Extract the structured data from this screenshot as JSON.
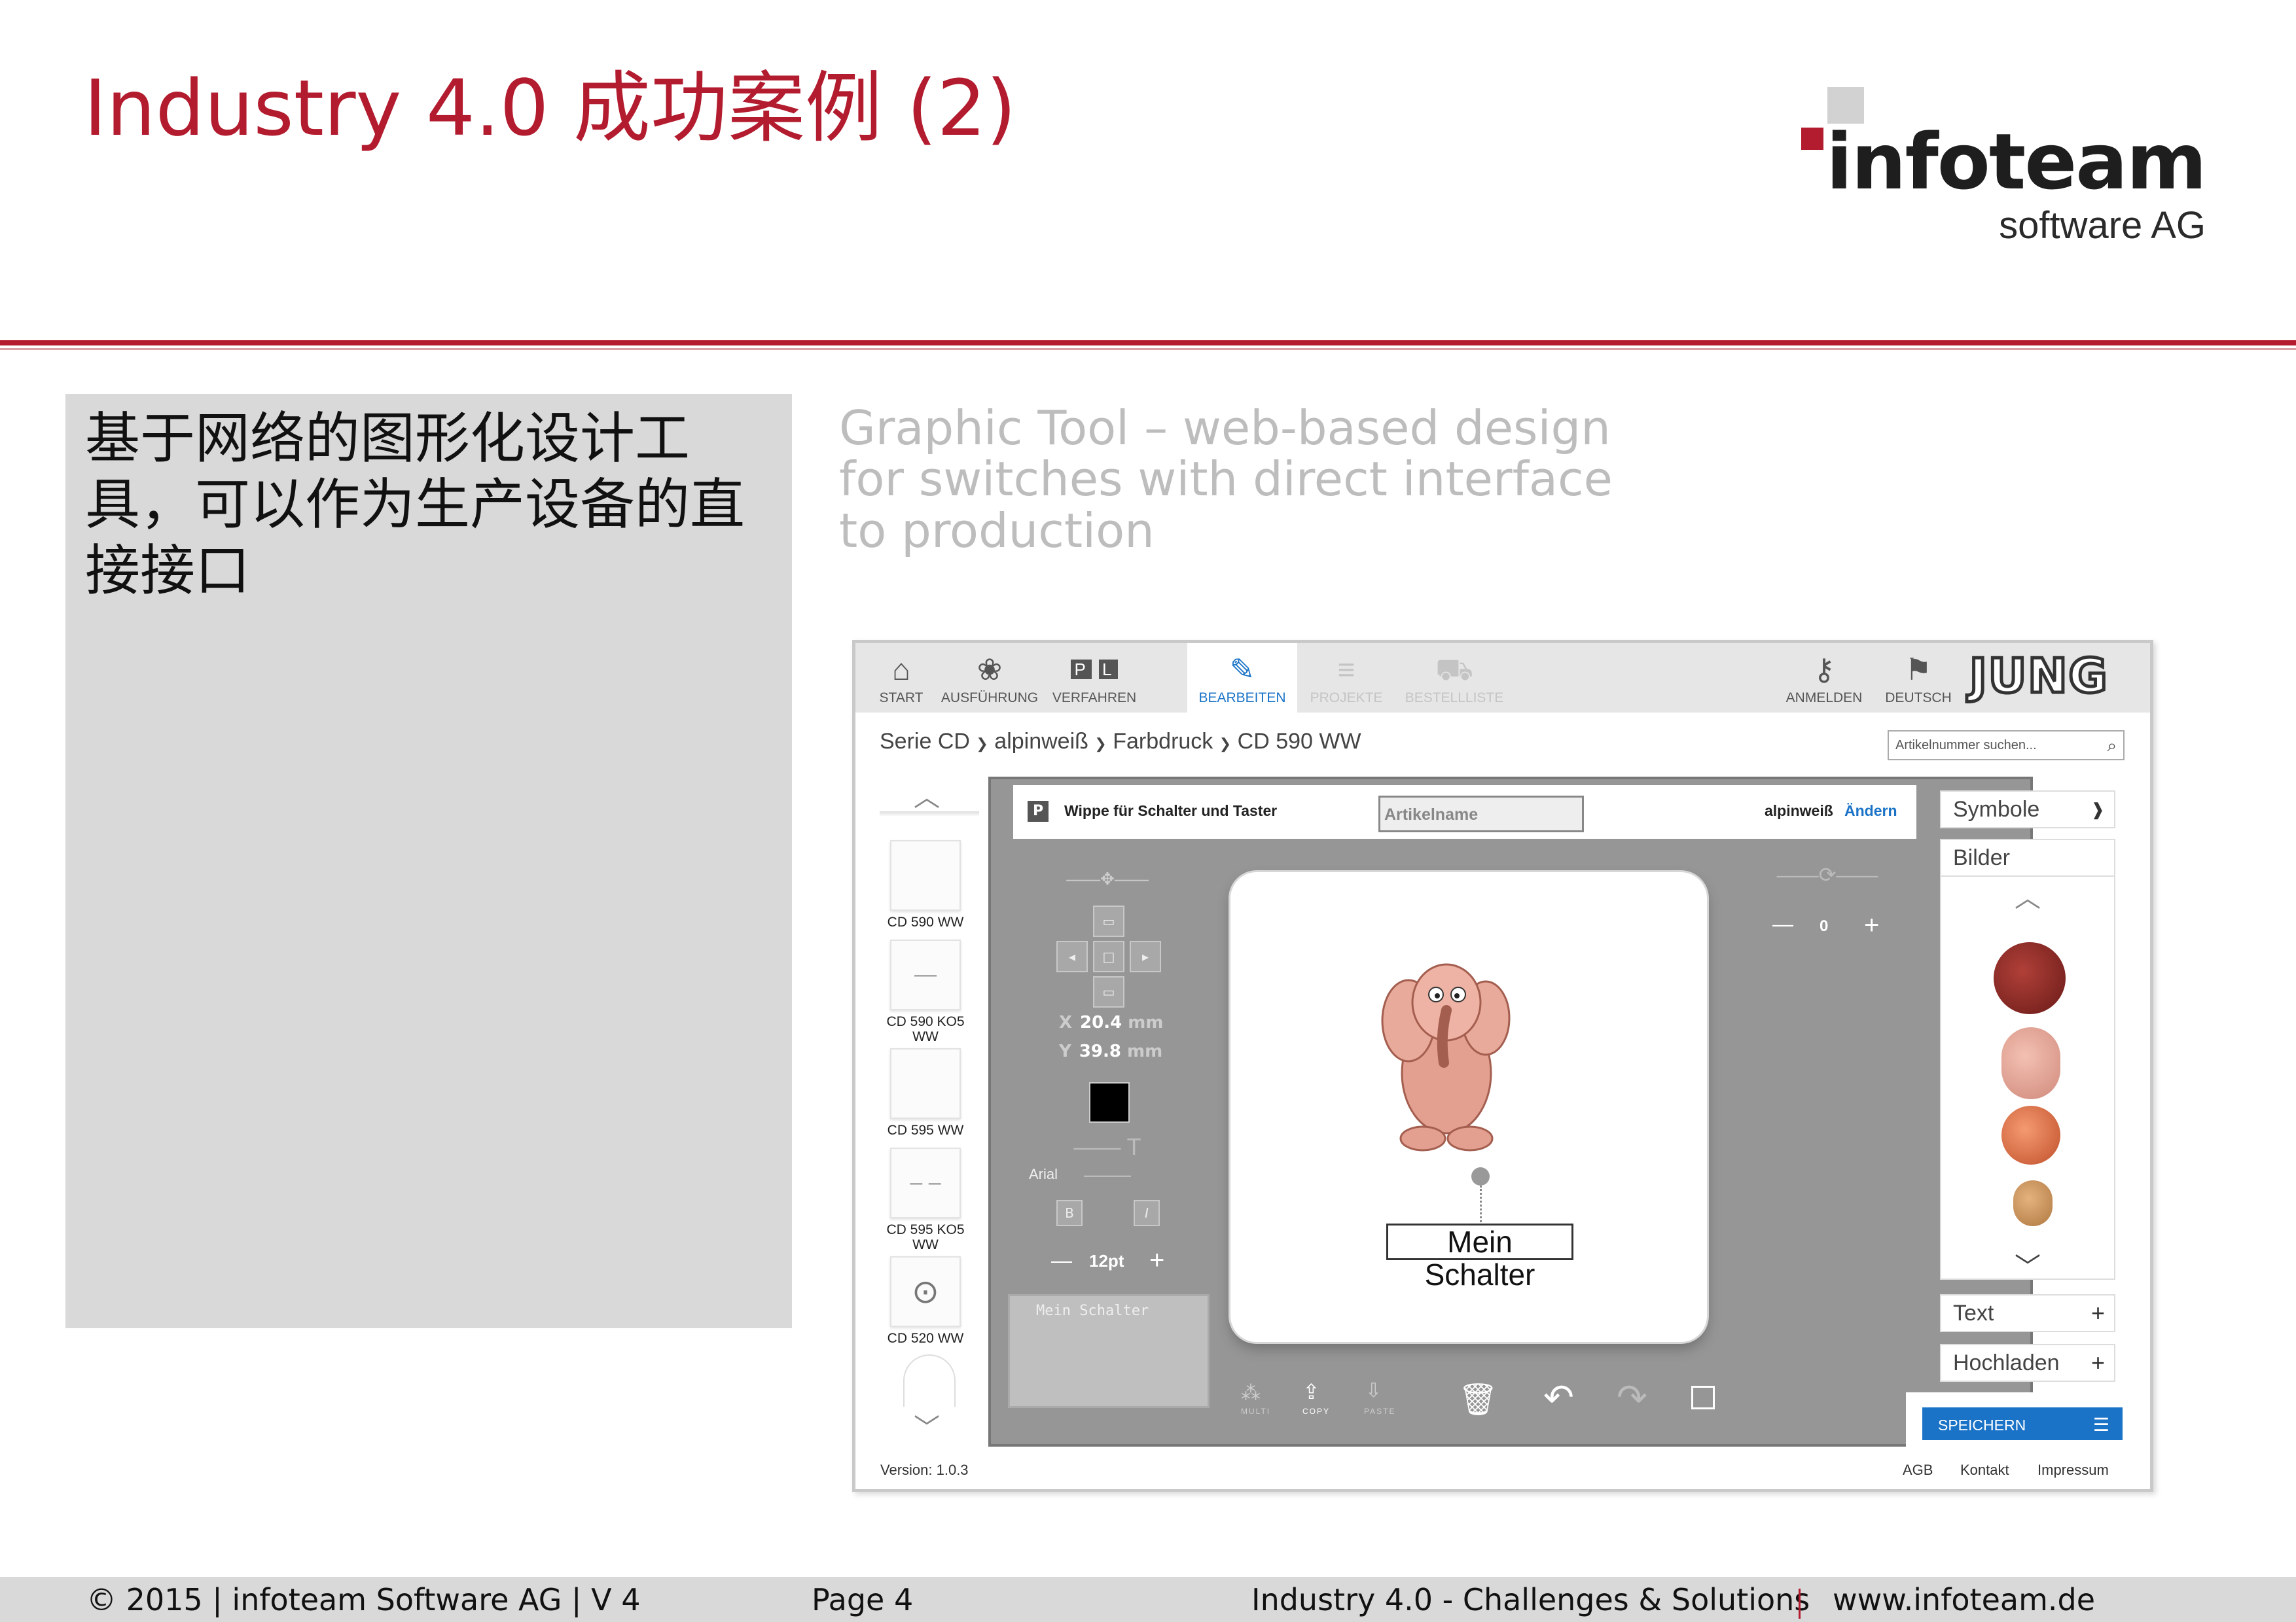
{
  "slide": {
    "title": "Industry 4.0 成功案例 (2)",
    "logo": {
      "word": "infoteam",
      "sub": "software AG"
    },
    "colors": {
      "brand_red": "#b31b2e",
      "app_blue": "#1a73c7",
      "canvas_grey": "#969696"
    }
  },
  "left_box": {
    "text": "基于网络的图形化设计工具，可以作为生产设备的直接接口"
  },
  "caption": {
    "lines": [
      "Graphic Tool – web-based design",
      "for switches with direct interface",
      "to production"
    ]
  },
  "app": {
    "toolbar": {
      "start": "START",
      "ausfuehrung": "AUSFÜHRUNG",
      "verfahren": "VERFAHREN",
      "bearbeiten": "BEARBEITEN",
      "projekte": "PROJEKTE",
      "bestellliste": "BESTELLLISTE",
      "anmelden": "ANMELDEN",
      "deutsch": "DEUTSCH",
      "brand": "JUNG",
      "icons": [
        "home-icon",
        "palette-icon",
        "pl-icon",
        "pencil-icon",
        "list-icon",
        "cart-icon",
        "key-icon",
        "flag-icon"
      ]
    },
    "breadcrumb": [
      "Serie CD",
      "alpinweiß",
      "Farbdruck",
      "CD 590 WW"
    ],
    "breadcrumb_sep": "❯",
    "search": {
      "placeholder": "Artikelnummer suchen..."
    },
    "products": [
      {
        "label": "CD 590 WW",
        "glyph": ""
      },
      {
        "label": "CD 590 KO5 WW",
        "glyph": "—"
      },
      {
        "label": "CD 595 WW",
        "glyph": ""
      },
      {
        "label": "CD 595 KO5 WW",
        "glyph": "– –"
      },
      {
        "label": "CD 520 WW",
        "glyph": "⊙"
      }
    ],
    "panel": {
      "p_badge": "P",
      "label": "Wippe für Schalter und Taster",
      "name_placeholder": "Artikelname",
      "color": "alpinweiß",
      "change": "Ändern"
    },
    "controls": {
      "x_label": "X",
      "x_value": "20.4",
      "y_label": "Y",
      "y_value": "39.8",
      "unit": "mm",
      "font": "Arial",
      "bold": "B",
      "italic": "I",
      "size": "12pt",
      "minus": "—",
      "plus": "+",
      "rotation": "0",
      "preview_text": "Mein Schalter"
    },
    "switch_label": "Mein Schalter",
    "bottom_tools": {
      "multi": "MULTI",
      "copy": "COPY",
      "paste": "PASTE"
    },
    "sidebar": {
      "symbole": "Symbole",
      "bilder": "Bilder",
      "text": "Text",
      "hochladen": "Hochladen",
      "save": "SPEICHERN"
    },
    "footer": {
      "version": "Version: 1.0.3",
      "agb": "AGB",
      "kontakt": "Kontakt",
      "impressum": "Impressum"
    }
  },
  "footer": {
    "copyright": "© 2015 | infoteam Software AG | V 4",
    "page": "Page 4",
    "title": "Industry 4.0 - Challenges & Solutions",
    "url": "www.infoteam.de"
  }
}
